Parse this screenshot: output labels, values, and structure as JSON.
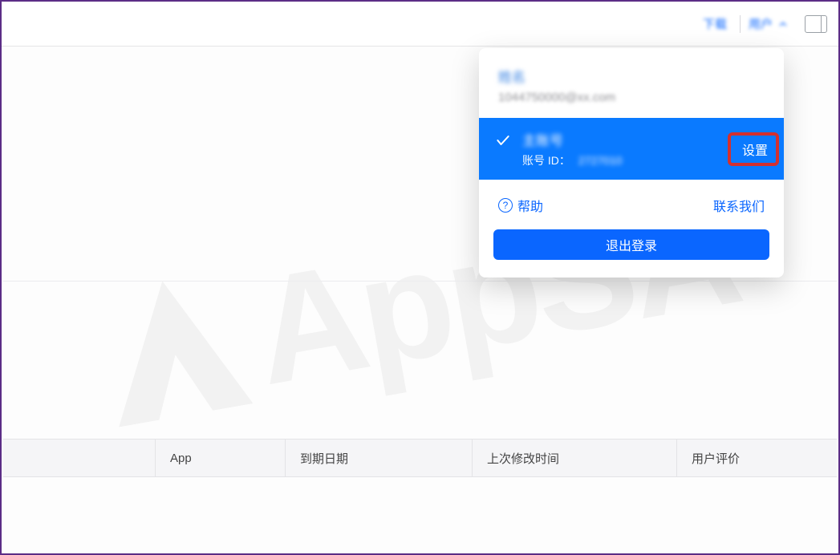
{
  "watermark_text": "AppSA",
  "topbar": {
    "link_label": "下载",
    "user_label": "用户"
  },
  "dropdown": {
    "header_name": "姓名",
    "header_email": "1044750000@xx.com",
    "selected": {
      "title": "主账号",
      "account_id_label": "账号 ID：",
      "account_id_value": "2727010",
      "settings_label": "设置"
    },
    "help_label": "帮助",
    "contact_label": "联系我们",
    "logout_label": "退出登录"
  },
  "columns": {
    "c1": "App",
    "c2": "到期日期",
    "c3": "上次修改时间",
    "c4": "用户评价"
  }
}
